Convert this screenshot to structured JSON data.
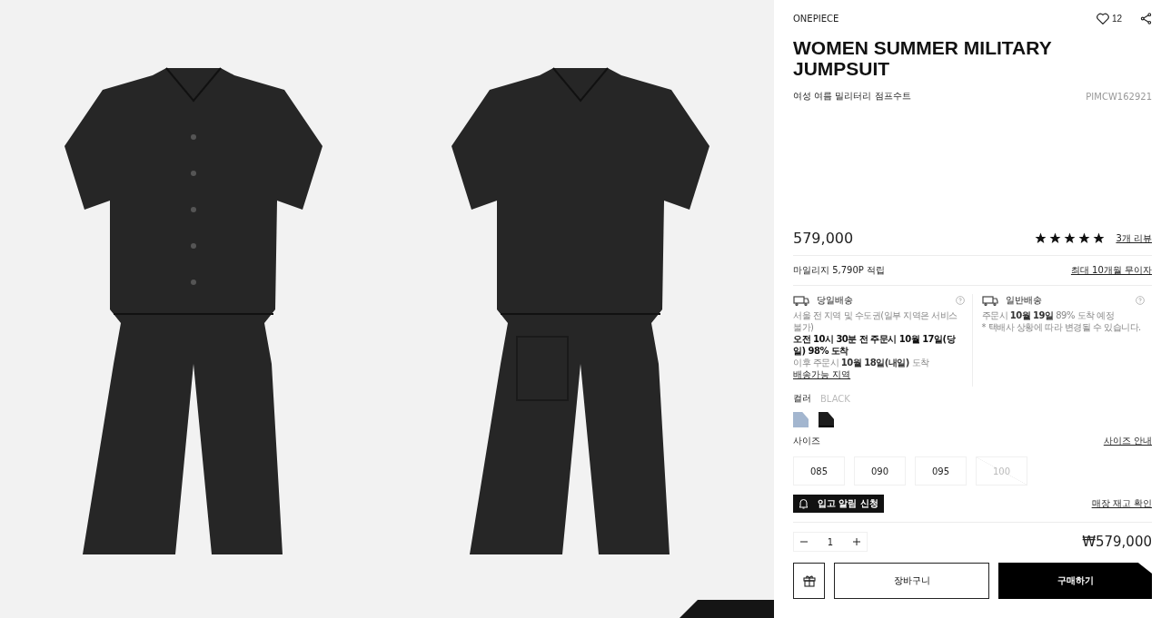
{
  "product": {
    "category": "ONEPIECE",
    "likes": "12",
    "title": "WOMEN SUMMER MILITARY JUMPSUIT",
    "subtitle": "여성 여름 밀리터리 점프수트",
    "code": "PIMCW162921",
    "price": "579,000",
    "stars": 5,
    "reviews": "3개 리뷰"
  },
  "mileage": {
    "text": "마일리지 5,790P 적립",
    "link": "최대 10개월 무이자"
  },
  "delivery": [
    {
      "title": "당일배송",
      "lines": [
        {
          "kind": "note",
          "text": "서울 전 지역 및 수도권(일부 지역은 서비스 불가)"
        },
        {
          "kind": "emphasis",
          "text": "오전 10시 30분 전 주문시 10월 17일(당일) 98% 도착"
        },
        {
          "kind": "note",
          "text": "이후 주문시 **10월 18일(내일)** 도착"
        }
      ],
      "link": "배송가능 지역"
    },
    {
      "title": "일반배송",
      "lines": [
        {
          "kind": "note",
          "text": "주문시 **10월 19일** 89% 도착 예정"
        },
        {
          "kind": "note",
          "text": "* 택배사 상황에 따라 변경될 수 있습니다."
        }
      ]
    }
  ],
  "color": {
    "label": "컬러",
    "value": "BLACK",
    "swatches": [
      {
        "color": "#a3b6cf",
        "selected": false
      },
      {
        "color": "#1c1c1c",
        "selected": true
      }
    ]
  },
  "size": {
    "label": "사이즈",
    "guide": "사이즈 안내",
    "options": [
      {
        "label": "085",
        "disabled": false
      },
      {
        "label": "090",
        "disabled": false
      },
      {
        "label": "095",
        "disabled": false
      },
      {
        "label": "100",
        "disabled": true
      }
    ]
  },
  "notify": "입고 알림 신청",
  "stock": "매장 재고 확인",
  "quantity": "1",
  "total": "₩579,000",
  "buttons": {
    "cart": "장바구니",
    "buy": "구매하기"
  }
}
